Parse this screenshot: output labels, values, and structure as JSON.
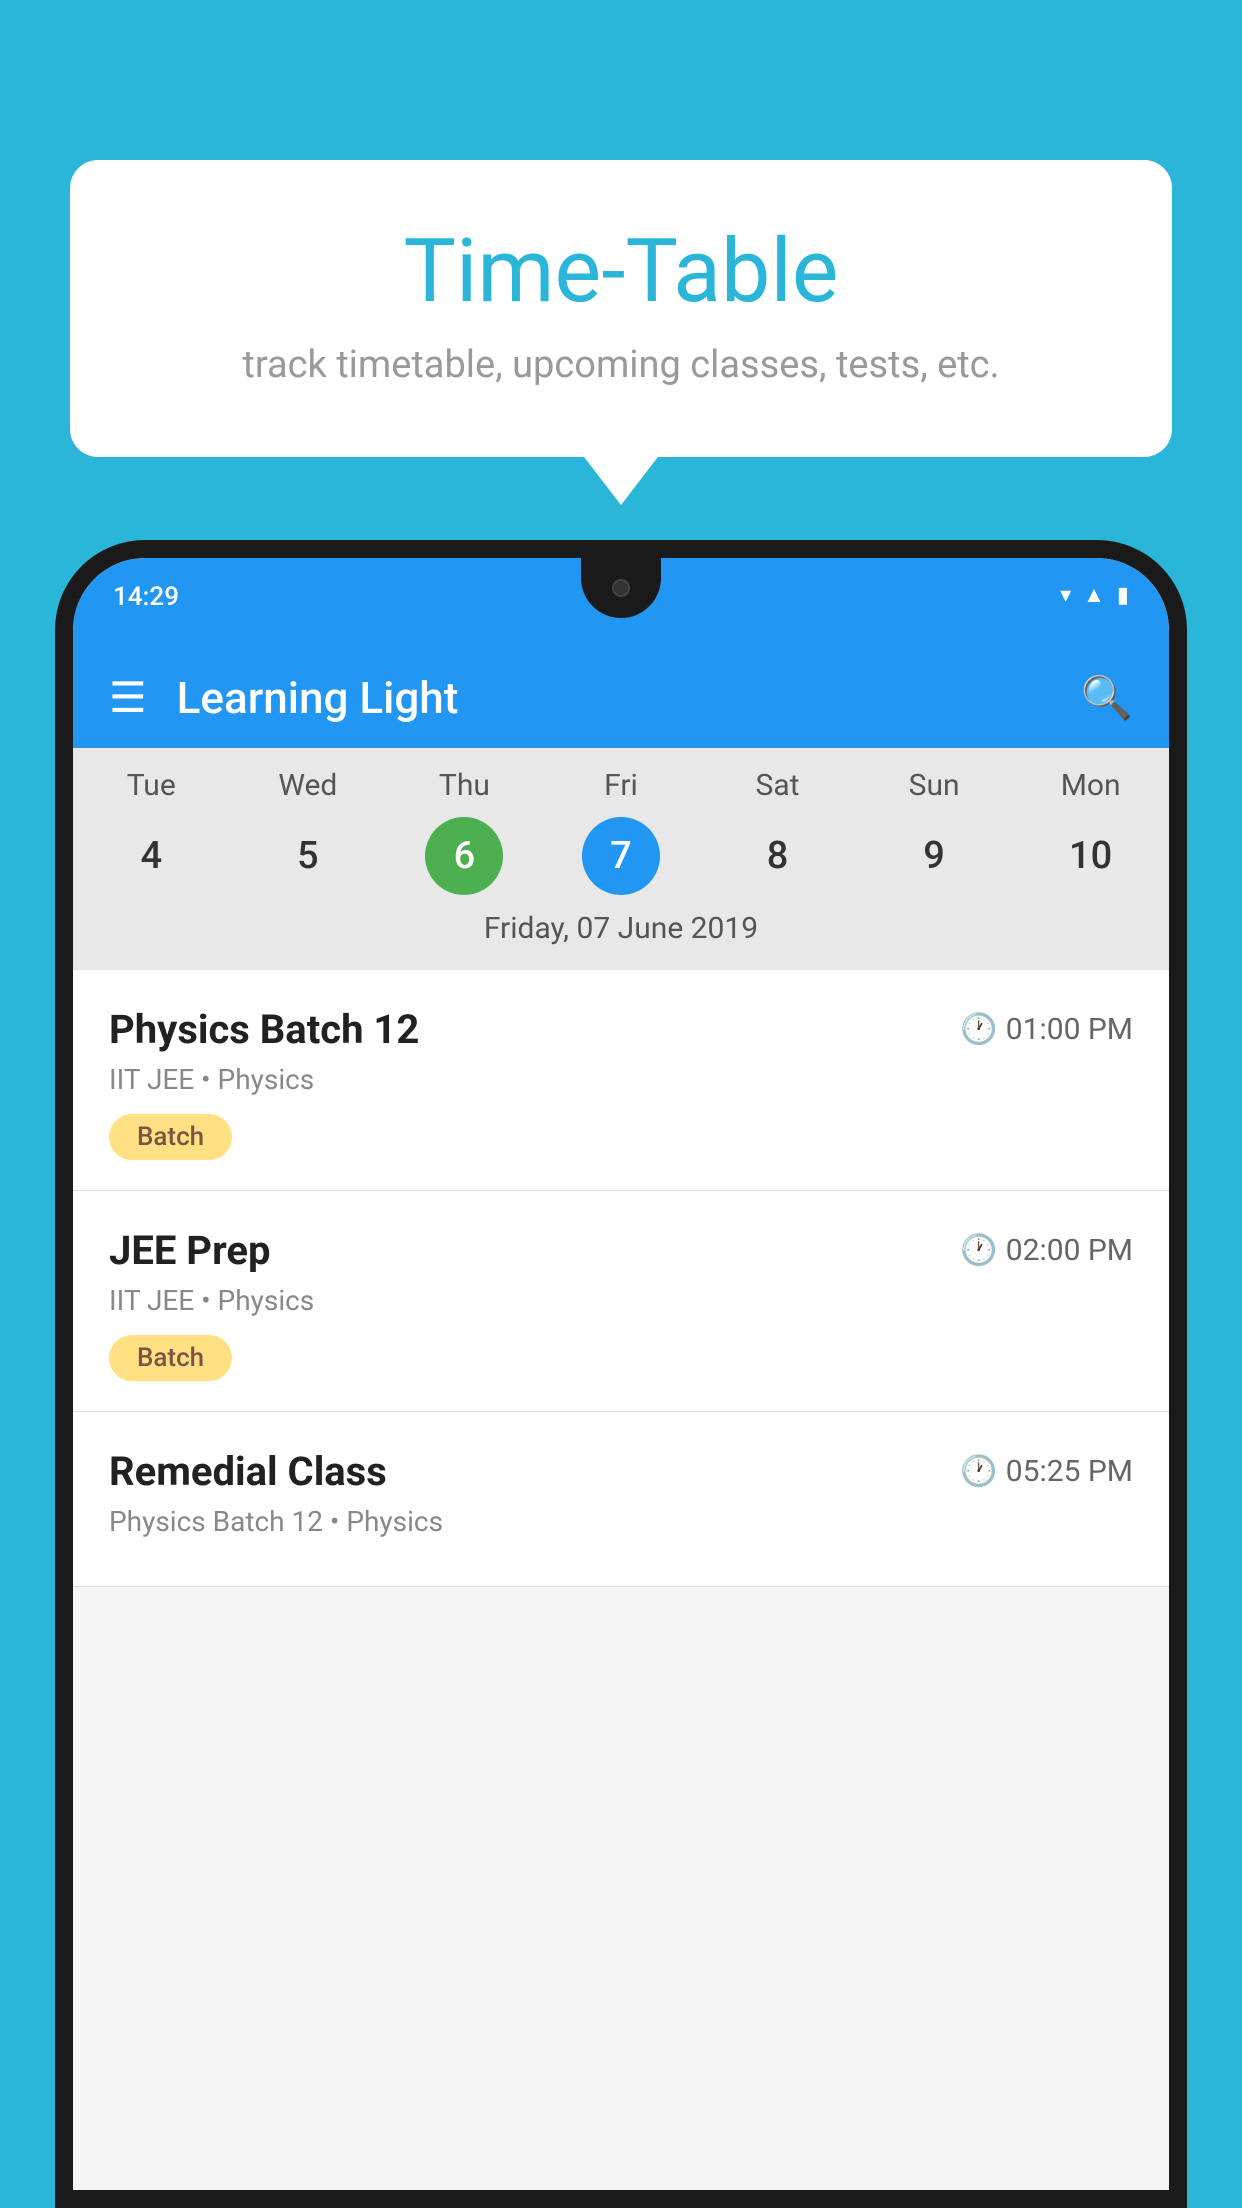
{
  "background_color": "#29b6d8",
  "tooltip": {
    "title": "Time-Table",
    "subtitle": "track timetable, upcoming classes, tests, etc."
  },
  "phone": {
    "status_bar": {
      "time": "14:29",
      "icons": [
        "wifi",
        "signal",
        "battery"
      ]
    },
    "app_bar": {
      "title": "Learning Light",
      "menu_icon": "hamburger",
      "search_icon": "search"
    },
    "calendar": {
      "days": [
        {
          "label": "Tue",
          "num": "4",
          "state": "normal"
        },
        {
          "label": "Wed",
          "num": "5",
          "state": "normal"
        },
        {
          "label": "Thu",
          "num": "6",
          "state": "today"
        },
        {
          "label": "Fri",
          "num": "7",
          "state": "selected"
        },
        {
          "label": "Sat",
          "num": "8",
          "state": "normal"
        },
        {
          "label": "Sun",
          "num": "9",
          "state": "normal"
        },
        {
          "label": "Mon",
          "num": "10",
          "state": "normal"
        }
      ],
      "selected_date": "Friday, 07 June 2019"
    },
    "schedule": [
      {
        "title": "Physics Batch 12",
        "time": "01:00 PM",
        "subtitle": "IIT JEE • Physics",
        "badge": "Batch"
      },
      {
        "title": "JEE Prep",
        "time": "02:00 PM",
        "subtitle": "IIT JEE • Physics",
        "badge": "Batch"
      },
      {
        "title": "Remedial Class",
        "time": "05:25 PM",
        "subtitle": "Physics Batch 12 • Physics",
        "badge": ""
      }
    ]
  }
}
